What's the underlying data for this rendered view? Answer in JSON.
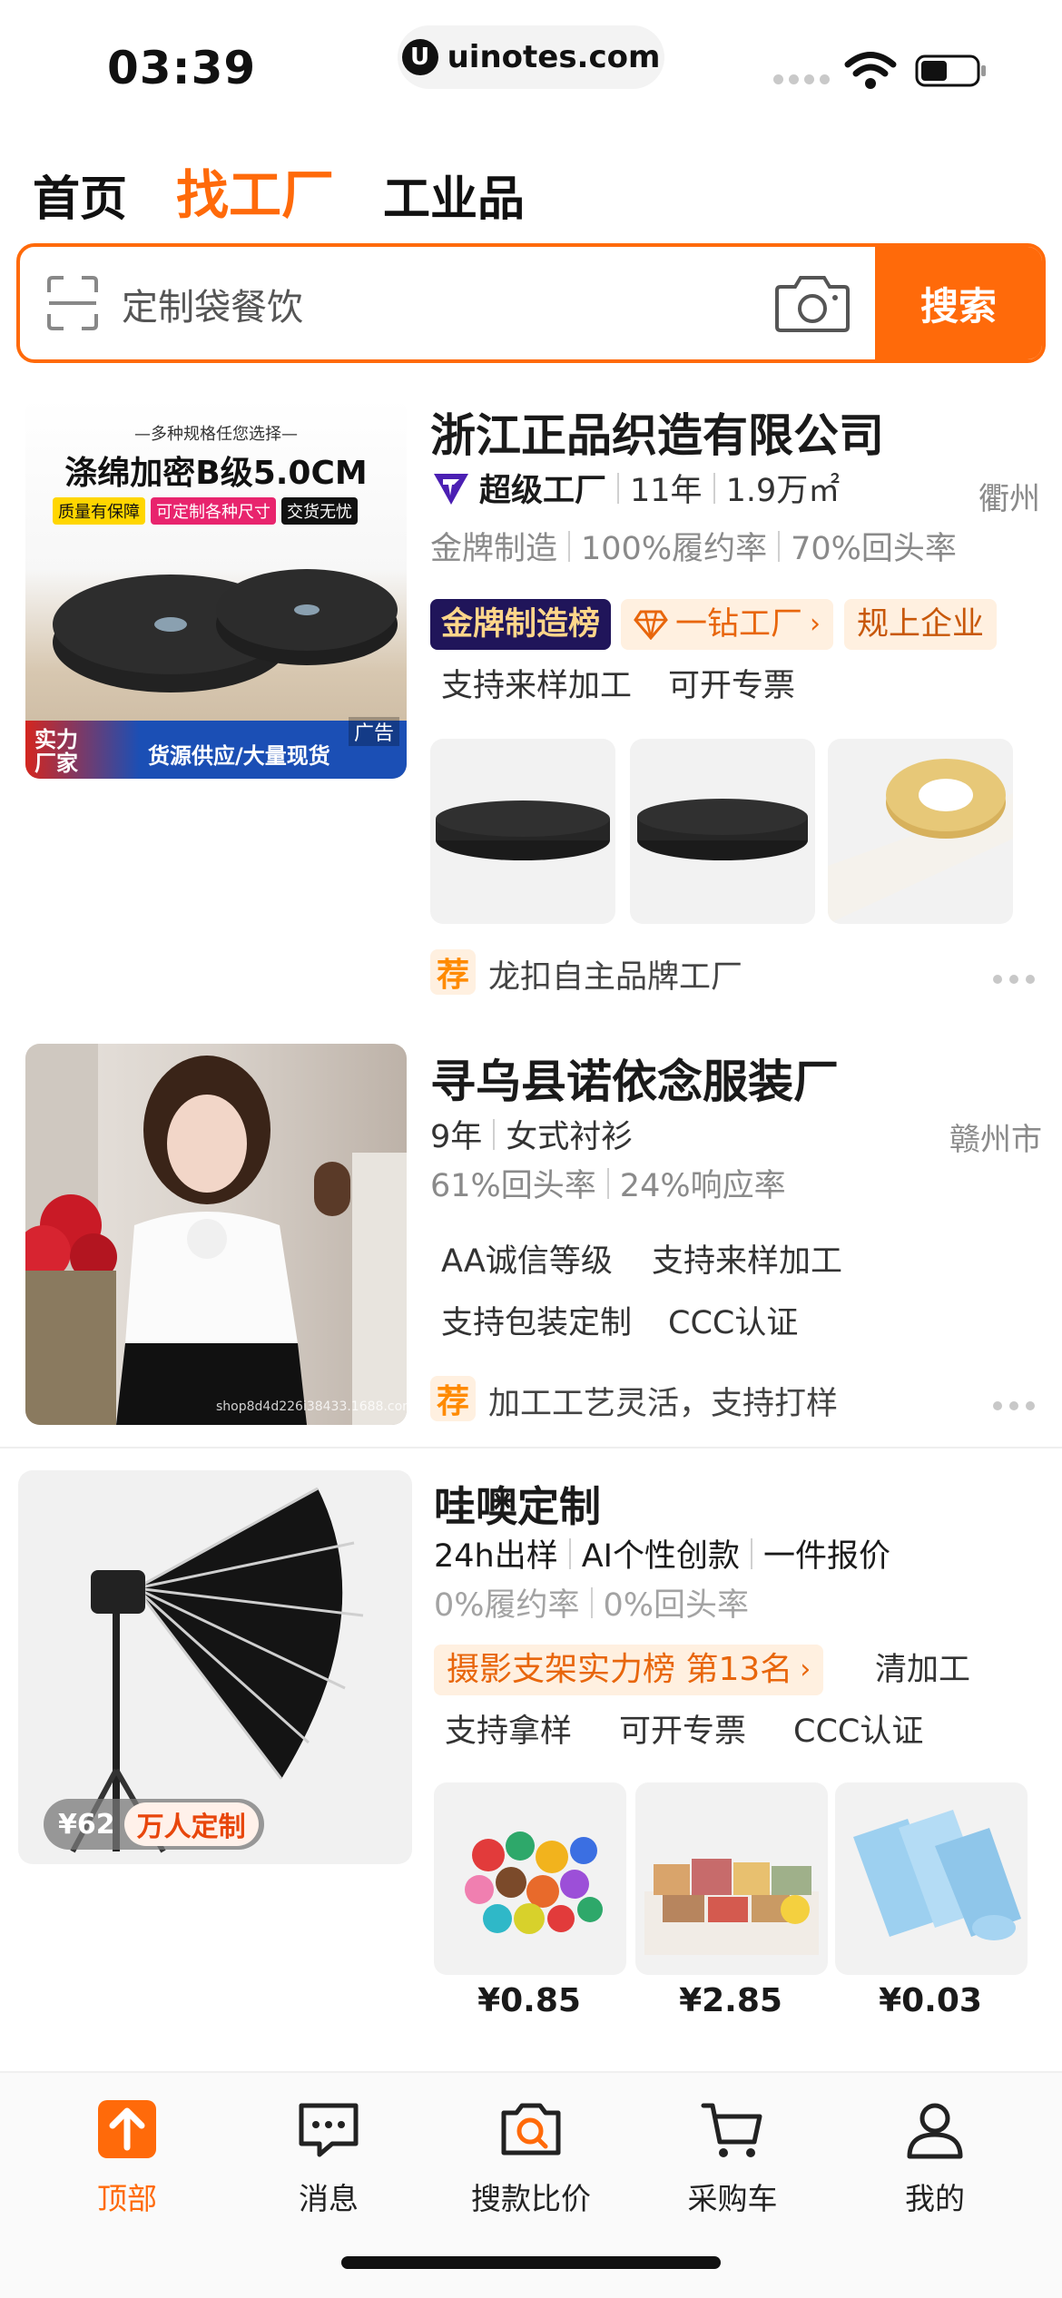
{
  "status_bar": {
    "time": "03:39",
    "url": "uinotes.com"
  },
  "tabs": [
    {
      "label": "首页",
      "active": false
    },
    {
      "label": "找工厂",
      "active": true
    },
    {
      "label": "工业品",
      "active": false
    }
  ],
  "search": {
    "placeholder": "定制袋餐饮",
    "button": "搜索"
  },
  "cards": [
    {
      "title": "浙江正品织造有限公司",
      "image_text": {
        "top": "—多种规格任您选择—",
        "headline": "涤绵加密B级5.0CM",
        "badge1": "质量有保障",
        "badge2": "可定制各种尺寸",
        "badge3": "交货无忧",
        "bottom_brand": "实力厂家",
        "bottom_text": "货源供应/大量现货",
        "ad": "广告"
      },
      "meta": {
        "level": "超级工厂",
        "years": "11年",
        "area": "1.9万㎡",
        "location": "衢州"
      },
      "stats": [
        "金牌制造",
        "100%履约率",
        "70%回头率"
      ],
      "rank_tag": "金牌制造榜",
      "diamond_tag": "一钻工厂",
      "enterprise_tag": "规上企业",
      "tags": [
        "支持来样加工",
        "可开专票"
      ],
      "recommend": {
        "icon": "荐",
        "text": "龙扣自主品牌工厂"
      }
    },
    {
      "title": "寻乌县诺依念服装厂",
      "meta": {
        "years": "9年",
        "category": "女式衬衫",
        "location": "赣州市"
      },
      "stats": [
        "61%回头率",
        "24%响应率"
      ],
      "tags": [
        "AA诚信等级",
        "支持来样加工",
        "支持包装定制",
        "CCC认证"
      ],
      "image_text": {
        "watermark": "shop8d4d226i38433.1688.com"
      },
      "recommend": {
        "icon": "荐",
        "text": "加工工艺灵活，支持打样"
      }
    },
    {
      "title": "哇噢定制",
      "meta": [
        "24h出样",
        "AI个性创款",
        "一件报价"
      ],
      "stats": [
        "0%履约率",
        "0%回头率"
      ],
      "rank_tag": "摄影支架实力榜 第13名",
      "tags": [
        "清加工",
        "支持拿样",
        "可开专票",
        "CCC认证"
      ],
      "thumb_badge": {
        "price": "¥62",
        "label": "万人定制"
      },
      "products": [
        {
          "price": "¥0.85",
          "image": "colorful-figurines"
        },
        {
          "price": "¥2.85",
          "image": "gift-boxes"
        },
        {
          "price": "¥0.03",
          "image": "blue-mailer-bags"
        }
      ]
    }
  ],
  "bottom_nav": [
    {
      "label": "顶部",
      "icon": "arrow-up-icon",
      "active": true
    },
    {
      "label": "消息",
      "icon": "message-icon",
      "active": false
    },
    {
      "label": "搜款比价",
      "icon": "camera-search-icon",
      "active": false
    },
    {
      "label": "采购车",
      "icon": "cart-icon",
      "active": false
    },
    {
      "label": "我的",
      "icon": "profile-icon",
      "active": false
    }
  ],
  "colors": {
    "accent": "#ff6a0a",
    "gold_tag_bg": "#20155a"
  }
}
